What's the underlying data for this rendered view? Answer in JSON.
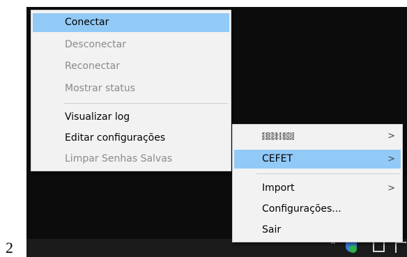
{
  "page_number": "2",
  "main_menu": {
    "items": [
      {
        "label": "Conectar",
        "state": "highlighted"
      },
      {
        "label": "Desconectar",
        "state": "disabled"
      },
      {
        "label": "Reconectar",
        "state": "disabled"
      },
      {
        "label": "Mostrar status",
        "state": "disabled"
      },
      {
        "label": "Visualizar log",
        "state": "enabled"
      },
      {
        "label": "Editar configurações",
        "state": "enabled"
      },
      {
        "label": "Limpar Senhas Salvas",
        "state": "disabled"
      }
    ]
  },
  "context_menu": {
    "items": [
      {
        "label": "",
        "note": "obscured/pixelated label",
        "has_submenu": true
      },
      {
        "label": "CEFET",
        "has_submenu": true,
        "state": "highlighted"
      },
      {
        "label": "Import",
        "has_submenu": true
      },
      {
        "label": "Configurações...",
        "has_submenu": false
      },
      {
        "label": "Sair",
        "has_submenu": false
      }
    ],
    "submenu_arrow": ">"
  },
  "taskbar": {
    "icons": [
      "chevron-up-icon",
      "openvpn-shield-icon",
      "device-icon",
      "tray-icon"
    ]
  },
  "colors": {
    "highlight": "#91c9f7",
    "menu_bg": "#f2f2f2",
    "disabled_text": "#8a8a8a",
    "desktop_bg": "#0c0c0c",
    "vpn_check": "#2db34a"
  }
}
